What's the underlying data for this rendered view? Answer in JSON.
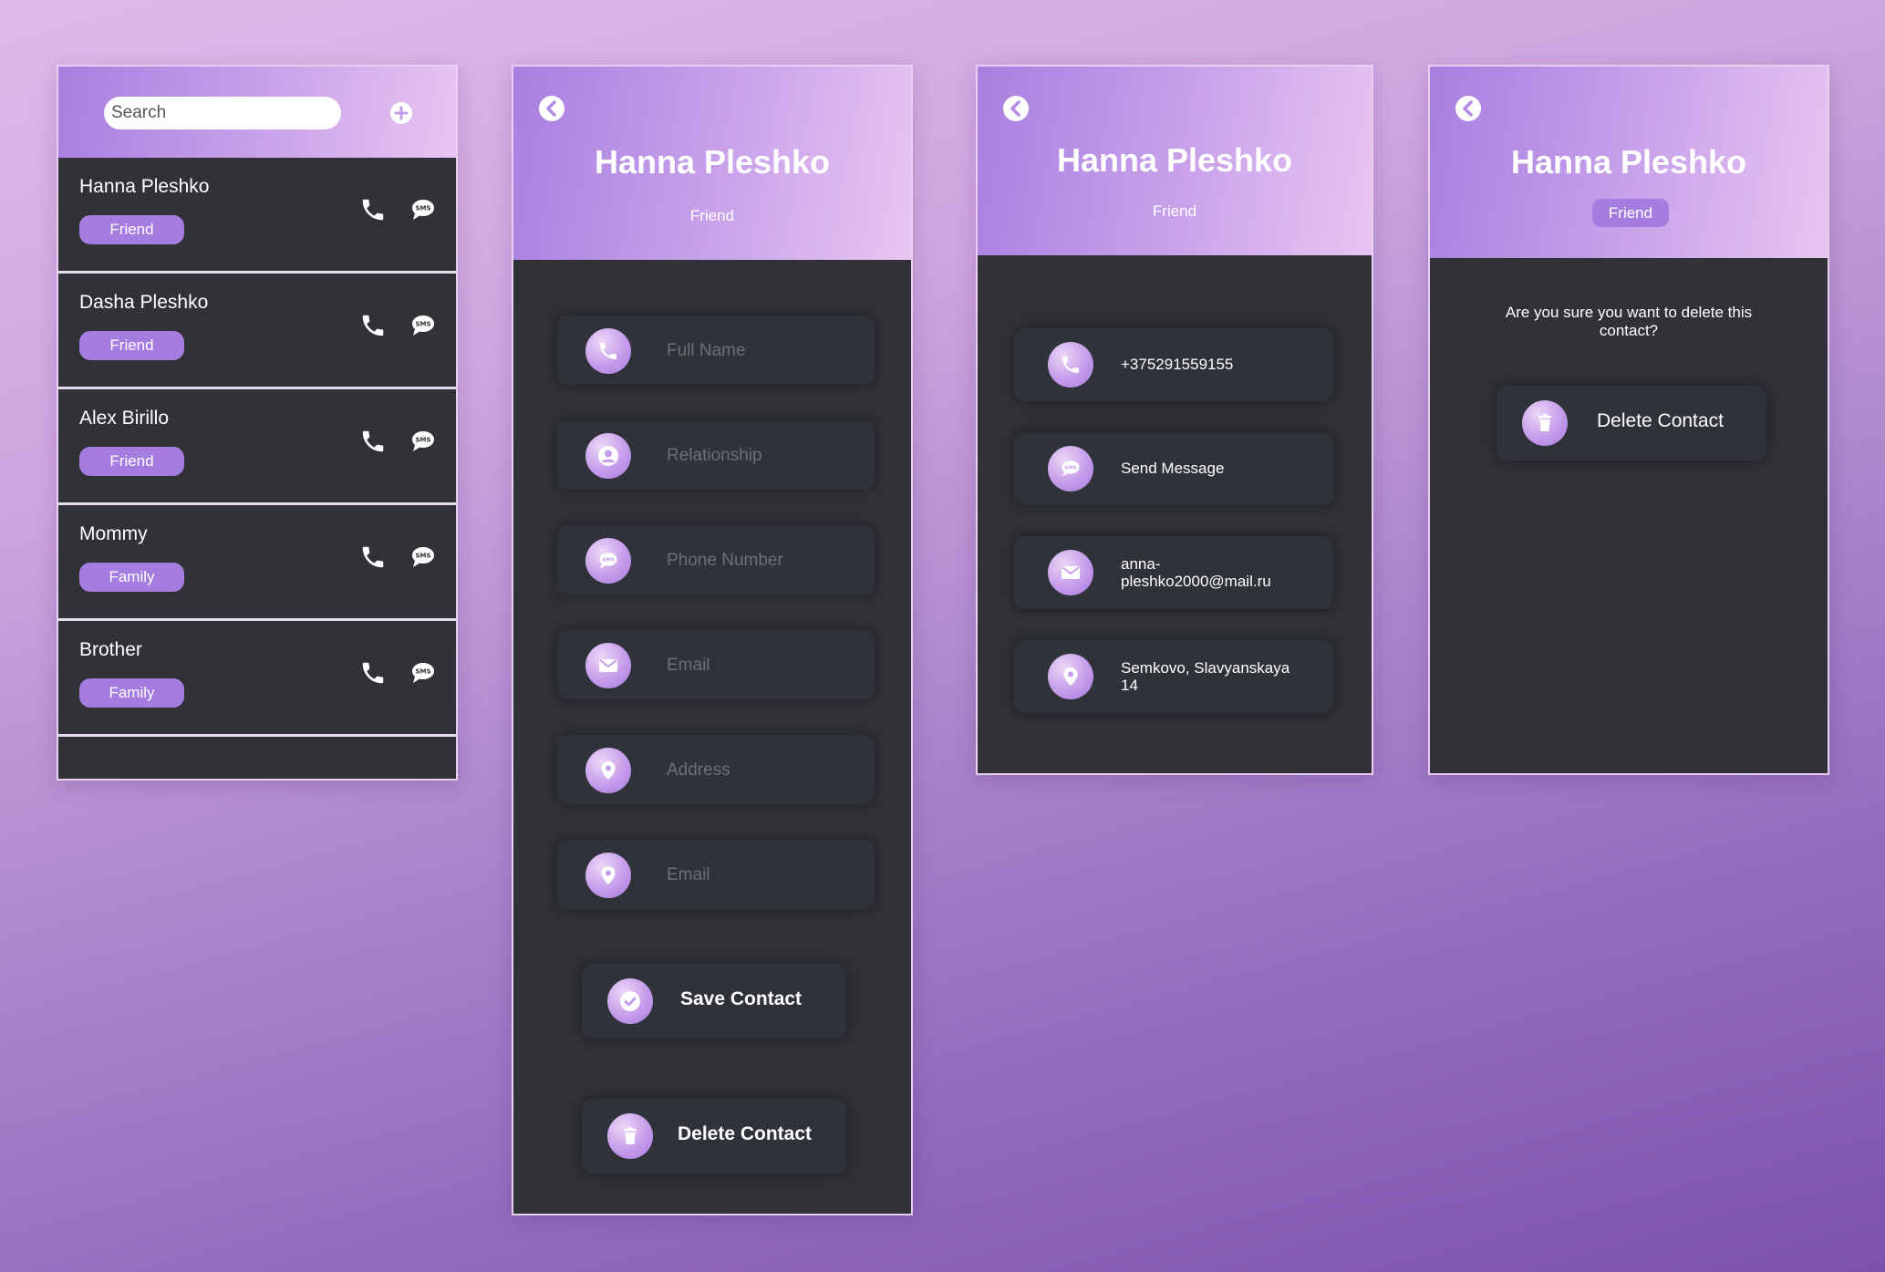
{
  "list_screen": {
    "search_placeholder": "Search",
    "add_icon": "plus-circle-icon",
    "contacts": [
      {
        "name": "Hanna Pleshko",
        "tag": "Friend"
      },
      {
        "name": "Dasha Pleshko",
        "tag": "Friend"
      },
      {
        "name": "Alex Birillo",
        "tag": "Friend"
      },
      {
        "name": "Mommy",
        "tag": "Family"
      },
      {
        "name": "Brother",
        "tag": "Family"
      }
    ]
  },
  "edit_screen": {
    "name": "Hanna Pleshko",
    "relationship": "Friend",
    "fields": [
      {
        "placeholder": "Full Name",
        "icon": "phone-icon"
      },
      {
        "placeholder": "Relationship",
        "icon": "user-icon"
      },
      {
        "placeholder": "Phone Number",
        "icon": "sms-icon"
      },
      {
        "placeholder": "Email",
        "icon": "mail-icon"
      },
      {
        "placeholder": "Address",
        "icon": "location-icon"
      },
      {
        "placeholder": "Email",
        "icon": "location-icon"
      }
    ],
    "save_label": "Save Contact",
    "delete_label": "Delete Contact"
  },
  "details_screen": {
    "name": "Hanna Pleshko",
    "relationship": "Friend",
    "phone": "+375291559155",
    "message": "Send Message",
    "email_line1": "anna-",
    "email_line2": "pleshko2000@mail.ru",
    "address_line1": "Semkovo, Slavyanskaya",
    "address_line2": "14"
  },
  "delete_screen": {
    "name": "Hanna Pleshko",
    "relationship": "Friend",
    "question_line1": "Are you sure you want to delete this",
    "question_line2": "contact?",
    "delete_label": "Delete Contact"
  },
  "colors": {
    "accent": "#a57ce0",
    "panel_bg": "#303238",
    "header_gradient_start": "#a77fe0",
    "header_gradient_end": "#e8c5f1"
  }
}
